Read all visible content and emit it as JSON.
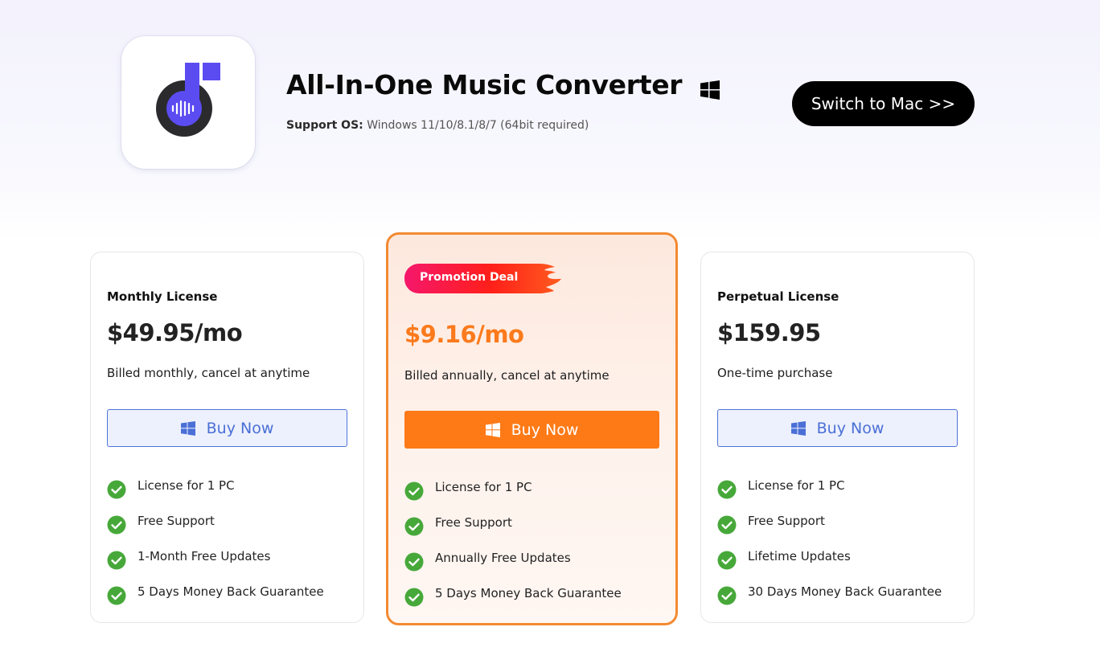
{
  "header": {
    "app_icon": "music-note-disc-icon",
    "title": "All-In-One Music Converter",
    "platform_icon": "windows-icon",
    "support_os_label": "Support OS:",
    "support_os_value": " Windows 11/10/8.1/8/7 (64bit required)",
    "switch_button": "Switch to Mac >>"
  },
  "colors": {
    "accent_orange": "#fd7a17",
    "accent_blue": "#4a6fd6",
    "check_green": "#47a83a",
    "brand_purple": "#5b4cf2",
    "promo_gradient": [
      "#f5176b",
      "#ff2a1a",
      "#ff5a1a"
    ]
  },
  "plans": [
    {
      "name": "Monthly License",
      "price": "$49.95/mo",
      "billing": "Billed monthly, cancel at anytime",
      "button": "Buy Now",
      "button_icon": "windows-icon",
      "features": [
        "License for 1 PC",
        "Free Support",
        "1-Month Free Updates",
        "5 Days Money Back Guarantee"
      ]
    },
    {
      "badge": "Promotion Deal",
      "badge_icon": "flame-icon",
      "price": "$9.16/mo",
      "billing": "Billed annually, cancel at anytime",
      "button": "Buy Now",
      "button_icon": "windows-icon",
      "highlighted": true,
      "features": [
        "License for 1 PC",
        "Free Support",
        "Annually Free Updates",
        "5 Days Money Back Guarantee"
      ]
    },
    {
      "name": "Perpetual License",
      "price": "$159.95",
      "billing": "One-time purchase",
      "button": "Buy Now",
      "button_icon": "windows-icon",
      "features": [
        "License for 1 PC",
        "Free Support",
        "Lifetime Updates",
        "30 Days Money Back Guarantee"
      ]
    }
  ]
}
